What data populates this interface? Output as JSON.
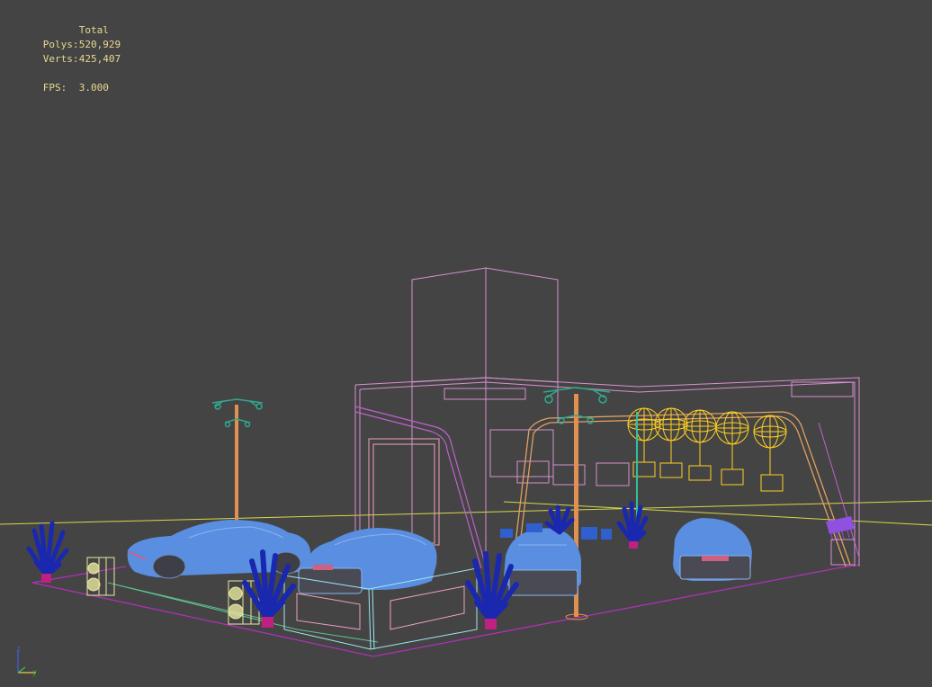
{
  "viewport": {
    "background": "#444444"
  },
  "stats": {
    "header": "Total",
    "polys_label": "Polys:",
    "polys_value": "520,929",
    "verts_label": "Verts:",
    "verts_value": "425,407",
    "fps_label": "FPS:",
    "fps_value": "3.000",
    "text_color": "#e8d890"
  },
  "axis_gizmo": {
    "z_label": "z",
    "y_label": "y",
    "x_label": "x"
  },
  "scene_colors": {
    "grid": "#d8d84a",
    "floor_outline": "#b030b8",
    "wall": "#d890d0",
    "car": "#5a8ee0",
    "car_wire": "#8ab4f0",
    "plant": "#1a28b0",
    "pot": "#c02080",
    "lamp_pole": "#e09050",
    "lamp_head": "#30a890",
    "globe": "#ffd020",
    "speaker": "#e8e8a0",
    "counter": "#a0e8f0",
    "panel": "#f0a0c0",
    "sign": "#9050e0",
    "railing": "#e0a060"
  },
  "labels_visible": false
}
